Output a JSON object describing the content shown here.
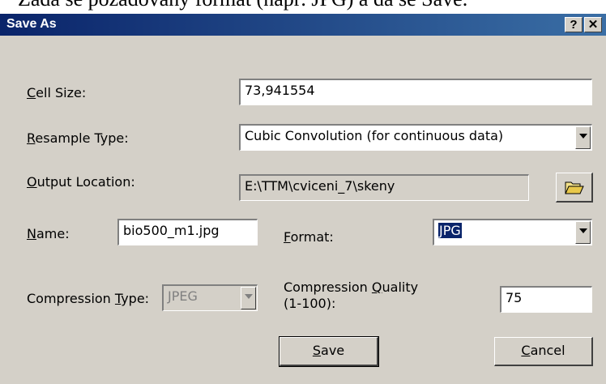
{
  "document_text": "Zadá se požadovaný formát (např. JPG) a dá se Save.",
  "dialog": {
    "title": "Save As",
    "help_button": "?",
    "close_button": "✕"
  },
  "fields": {
    "cell_size": {
      "label_prefix": "",
      "label_accel": "C",
      "label_rest": "ell Size:",
      "value": "73,941554"
    },
    "resample_type": {
      "label_accel": "R",
      "label_rest": "esample Type:",
      "value": "Cubic Convolution (for continuous data)"
    },
    "output_location": {
      "label_accel": "O",
      "label_rest": "utput Location:",
      "value": "E:\\TTM\\cviceni_7\\skeny"
    },
    "name": {
      "label_accel": "N",
      "label_rest": "ame:",
      "value": "bio500_m1.jpg"
    },
    "format": {
      "label_accel": "F",
      "label_rest": "ormat:",
      "value": "JPG"
    },
    "compression_type": {
      "label_prefix": "Compression ",
      "label_accel": "T",
      "label_rest": "ype:",
      "value": "JPEG"
    },
    "compression_quality": {
      "label_line1_prefix": "Compression ",
      "label_accel": "Q",
      "label_line1_rest": "uality",
      "label_line2": "(1-100):",
      "value": "75"
    }
  },
  "buttons": {
    "save": {
      "accel": "S",
      "rest": "ave"
    },
    "cancel": {
      "accel": "C",
      "rest": "ancel"
    }
  },
  "icons": {
    "folder": "open-folder-icon",
    "dropdown": "chevron-down-icon"
  }
}
